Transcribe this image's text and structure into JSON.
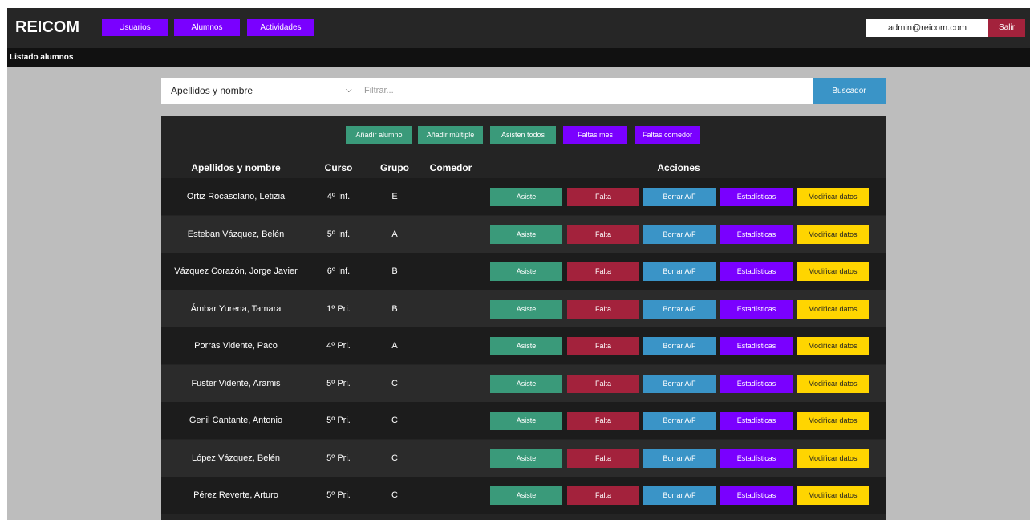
{
  "navbar": {
    "brand": "REICOM",
    "nav": [
      "Usuarios",
      "Alumnos",
      "Actividades"
    ],
    "user_email": "admin@reicom.com",
    "logout": "Salir"
  },
  "page_title": "Listado alumnos",
  "search": {
    "field_selected": "Apellidos y nombre",
    "placeholder": "Filtrar...",
    "button": "Buscador"
  },
  "toolbar": {
    "add_student": "Añadir alumno",
    "add_multiple": "Añadir múltiple",
    "all_attend": "Asisten todos",
    "absences_month": "Faltas mes",
    "absences_dining": "Faltas comedor"
  },
  "table": {
    "headers": [
      "Apellidos y nombre",
      "Curso",
      "Grupo",
      "Comedor",
      "Acciones"
    ],
    "row_actions": [
      "Asiste",
      "Falta",
      "Borrar A/F",
      "Estadísticas",
      "Modificar datos"
    ],
    "rows": [
      {
        "name": "Ortiz Rocasolano, Letizia",
        "course": "4º Inf.",
        "group": "E",
        "dining": ""
      },
      {
        "name": "Esteban Vázquez, Belén",
        "course": "5º Inf.",
        "group": "A",
        "dining": ""
      },
      {
        "name": "Vázquez Corazón, Jorge Javier",
        "course": "6º Inf.",
        "group": "B",
        "dining": ""
      },
      {
        "name": "Ámbar Yurena, Tamara",
        "course": "1º Pri.",
        "group": "B",
        "dining": ""
      },
      {
        "name": "Porras Vidente, Paco",
        "course": "4º Pri.",
        "group": "A",
        "dining": ""
      },
      {
        "name": "Fuster Vidente, Aramis",
        "course": "5º Pri.",
        "group": "C",
        "dining": ""
      },
      {
        "name": "Genil Cantante, Antonio",
        "course": "5º Pri.",
        "group": "C",
        "dining": ""
      },
      {
        "name": "López Vázquez, Belén",
        "course": "5º Pri.",
        "group": "C",
        "dining": ""
      },
      {
        "name": "Pérez Reverte, Arturo",
        "course": "5º Pri.",
        "group": "C",
        "dining": ""
      }
    ]
  },
  "colors": {
    "purple": "#7a00ff",
    "green": "#3a9a7a",
    "red": "#a3223c",
    "blue": "#3a94c7",
    "yellow": "#ffd500"
  },
  "icons": {
    "select_chevron": "chevron-down-icon"
  }
}
